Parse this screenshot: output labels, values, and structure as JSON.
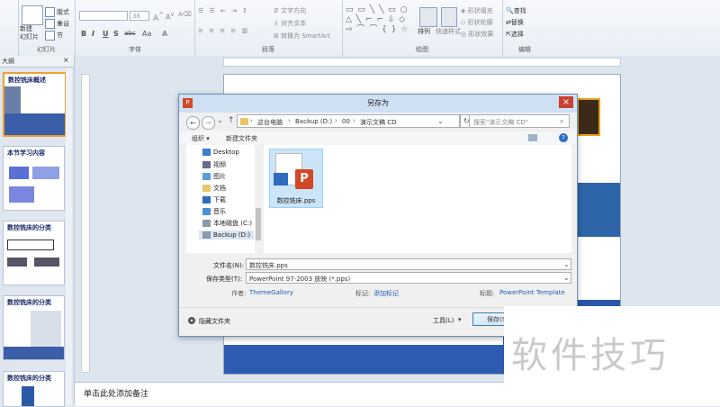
{
  "ribbon": {
    "clipboard_group": "",
    "slides_group": {
      "label": "幻灯片",
      "new_slide": "新建\n幻灯片",
      "layout": "版式",
      "reset": "重设",
      "section": "节"
    },
    "font_group": {
      "label": "字体",
      "font_name": "",
      "font_size": "36",
      "bold": "B",
      "italic": "I",
      "underline": "U",
      "shadow": "S",
      "strike": "abc",
      "case": "Aa"
    },
    "paragraph_group": {
      "label": "段落",
      "text_direction": "文字方向",
      "align_text": "对齐文本",
      "smartart": "转换为 SmartArt"
    },
    "drawing_group": {
      "label": "绘图",
      "arrange": "排列",
      "quick_styles": "快速样式",
      "shape_fill": "形状填充",
      "shape_outline": "形状轮廓",
      "shape_effects": "形状效果"
    },
    "editing_group": {
      "label": "编辑",
      "find": "查找",
      "replace": "替换",
      "select": "选择"
    }
  },
  "left_panel": {
    "tab": "大纲",
    "thumbs": [
      {
        "title": "数控铣床概述"
      },
      {
        "title": "本节学习内容"
      },
      {
        "title": "数控铣床的分类"
      },
      {
        "title": "数控铣床的分类"
      },
      {
        "title": "数控铣床的分类"
      }
    ]
  },
  "notes": {
    "placeholder": "单击此处添加备注"
  },
  "dialog": {
    "title": "另存为",
    "breadcrumb": [
      "这台电脑",
      "Backup (D:)",
      "00",
      "演示文稿 CD"
    ],
    "search_placeholder": "搜索\"演示文稿 CD\"",
    "organize": "组织 ▾",
    "new_folder": "新建文件夹",
    "nav_items": [
      "Desktop",
      "视频",
      "图片",
      "文档",
      "下载",
      "音乐",
      "本地磁盘 (C:)",
      "Backup (D:)"
    ],
    "file": {
      "name": "数控铣床.pps"
    },
    "filename_label": "文件名(N):",
    "filename_value": "数控铣床.pps",
    "filetype_label": "保存类型(T):",
    "filetype_value": "PowerPoint 97-2003 放映 (*.pps)",
    "author_label": "作者:",
    "author_value": "ThemeGallery",
    "tags_label": "标记:",
    "tags_value": "添加标记",
    "title_label": "标题:",
    "title_value": "PowerPoint Template",
    "hide_folders": "隐藏文件夹",
    "tools": "工具(L)",
    "save": "保存(S)"
  },
  "watermark": {
    "text": "软件技巧"
  },
  "colors": {
    "accent": "#1a5fb4",
    "titlebar": "#cfe0f3",
    "close": "#c84031",
    "ppt_orange": "#d24726"
  }
}
